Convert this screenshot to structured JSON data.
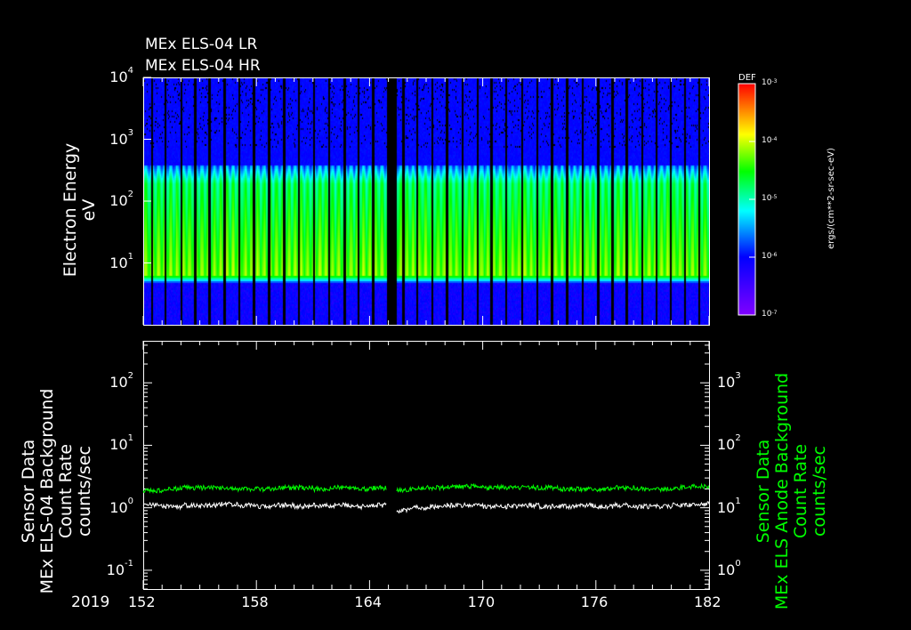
{
  "titles": [
    "MEx ELS-04 LR",
    "MEx ELS-04 HR"
  ],
  "colors": {
    "white_series": "#ffffff",
    "green_series": "#00ff00",
    "axis": "#ffffff"
  },
  "chart_data": [
    {
      "type": "heatmap",
      "title": "MEx ELS-04 LR / HR",
      "ylabel": "Electron Energy",
      "yunits": "eV",
      "yscale": "log",
      "ylim": [
        1,
        10000
      ],
      "ytick_labels": [
        "10",
        "10",
        "10",
        "10"
      ],
      "ytick_exponents": [
        "1",
        "2",
        "3",
        "4"
      ],
      "xlim": [
        152,
        182
      ],
      "colorbar": {
        "label": "DEF",
        "units": "ergs/(cm**2-sr-sec-eV)",
        "range": [
          1e-07,
          0.001
        ],
        "tick_labels": [
          "10",
          "10",
          "10",
          "10",
          "10"
        ],
        "tick_exponents": [
          "-3",
          "-4",
          "-5",
          "-6",
          "-7"
        ]
      },
      "data_gap": [
        164.9,
        165.4
      ],
      "peak_energy_band_eV": [
        5,
        300
      ]
    },
    {
      "type": "line",
      "xlabel": "2019",
      "xlim": [
        152,
        182
      ],
      "xtick_labels": [
        "152",
        "158",
        "164",
        "170",
        "176",
        "182"
      ],
      "left_axis": {
        "label_lines": [
          "Sensor Data",
          "MEx ELS-04 Background",
          "Count Rate",
          "counts/sec"
        ],
        "yscale": "log",
        "ylim": [
          0.05,
          470
        ],
        "tick_labels": [
          "10",
          "10",
          "10",
          "10"
        ],
        "tick_exponents": [
          "2",
          "1",
          "0",
          "-1"
        ]
      },
      "right_axis": {
        "label_lines": [
          "Sensor Data",
          "MEx ELS Anode Background",
          "Count Rate",
          "counts/sec"
        ],
        "yscale": "log",
        "ylim": [
          0.5,
          4700
        ],
        "tick_labels": [
          "10",
          "10",
          "10",
          "10"
        ],
        "tick_exponents": [
          "3",
          "2",
          "1",
          "0"
        ]
      },
      "series": [
        {
          "name": "ELS-04 background (left axis)",
          "color": "white",
          "x": [
            152,
            153,
            154,
            155,
            156,
            157,
            158,
            159,
            160,
            161,
            162,
            163,
            164,
            164.9,
            165.4,
            166,
            167,
            168,
            169,
            170,
            171,
            172,
            173,
            174,
            175,
            176,
            177,
            178,
            179,
            180,
            181,
            182
          ],
          "values": [
            1.1,
            1.05,
            1.1,
            1.1,
            1.15,
            1.1,
            1.05,
            1.1,
            1.05,
            1.1,
            1.1,
            1.05,
            1.1,
            1.0,
            0.9,
            1.0,
            1.05,
            1.1,
            1.1,
            1.05,
            1.05,
            1.1,
            1.05,
            1.05,
            1.1,
            1.05,
            1.1,
            1.05,
            1.05,
            1.1,
            1.15,
            1.2
          ]
        },
        {
          "name": "Anode background (right axis)",
          "color": "green",
          "x": [
            152,
            153,
            154,
            155,
            156,
            157,
            158,
            159,
            160,
            161,
            162,
            163,
            164,
            164.9,
            165.4,
            166,
            167,
            168,
            169,
            170,
            171,
            172,
            173,
            174,
            175,
            176,
            177,
            178,
            179,
            180,
            181,
            182
          ],
          "values": [
            19,
            20,
            21,
            21,
            21,
            20,
            20,
            21,
            21,
            20,
            21,
            20,
            21,
            20,
            19,
            20,
            21,
            22,
            22,
            21,
            21,
            21,
            21,
            20,
            20,
            20,
            21,
            20,
            20,
            21,
            22,
            26
          ]
        }
      ]
    }
  ]
}
